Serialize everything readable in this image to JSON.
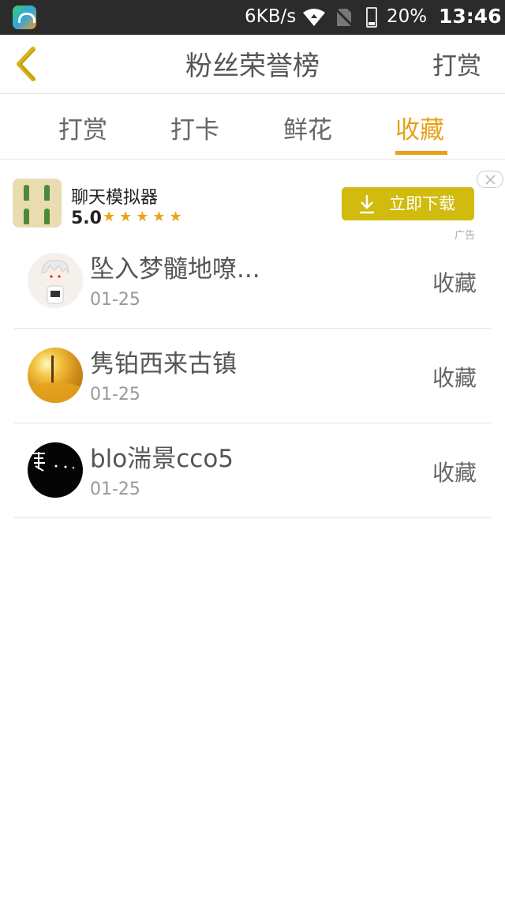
{
  "status_bar": {
    "net_speed": "6KB/s",
    "battery": "20%",
    "time": "13:46",
    "icons": [
      "app-icon",
      "wifi-icon",
      "no-sim-icon",
      "battery-icon"
    ]
  },
  "header": {
    "title": "粉丝荣誉榜",
    "right_action": "打赏"
  },
  "tabs": [
    {
      "label": "打赏",
      "active": false
    },
    {
      "label": "打卡",
      "active": false
    },
    {
      "label": "鲜花",
      "active": false
    },
    {
      "label": "收藏",
      "active": true
    }
  ],
  "ad": {
    "app_name": "聊天模拟器",
    "rating": "5.0",
    "stars": "★★★★★",
    "download_label": "立即下载",
    "ad_label": "广告"
  },
  "list": [
    {
      "name": "坠入梦髓地嘹...",
      "date": "01-25",
      "action": "收藏"
    },
    {
      "name": "隽铂西来古镇",
      "date": "01-25",
      "action": "收藏"
    },
    {
      "name": "blo湍景cco5",
      "date": "01-25",
      "action": "收藏"
    }
  ],
  "colors": {
    "accent": "#e8a11a",
    "download_button": "#d0bb0e",
    "status_bar": "#2b2b2b"
  }
}
